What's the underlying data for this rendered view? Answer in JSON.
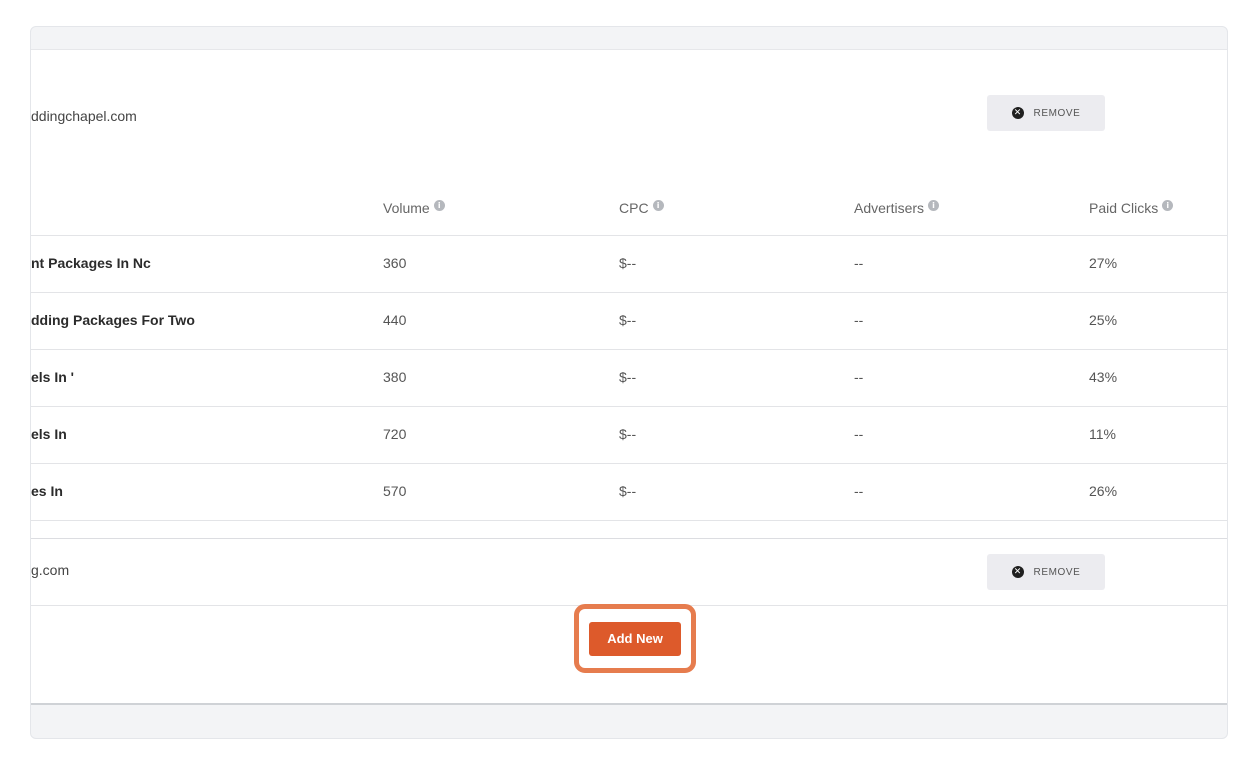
{
  "competitors": [
    {
      "domain": "ddingchapel.com",
      "remove_label": "REMOVE"
    },
    {
      "domain": "g.com",
      "remove_label": "REMOVE"
    }
  ],
  "table": {
    "headers": {
      "volume": "Volume",
      "cpc": "CPC",
      "advertisers": "Advertisers",
      "paid_clicks": "Paid Clicks"
    },
    "rows": [
      {
        "keyword": "nt Packages In Nc",
        "volume": "360",
        "cpc": "$--",
        "advertisers": "--",
        "paid_clicks": "27%"
      },
      {
        "keyword": "dding Packages For Two",
        "volume": "440",
        "cpc": "$--",
        "advertisers": "--",
        "paid_clicks": "25%"
      },
      {
        "keyword": "els In '",
        "volume": "380",
        "cpc": "$--",
        "advertisers": "--",
        "paid_clicks": "43%"
      },
      {
        "keyword": "els In",
        "volume": "720",
        "cpc": "$--",
        "advertisers": "--",
        "paid_clicks": "11%"
      },
      {
        "keyword": "es In",
        "volume": "570",
        "cpc": "$--",
        "advertisers": "--",
        "paid_clicks": "26%"
      }
    ]
  },
  "add_new_label": "Add New",
  "icons": {
    "remove": "close-circle-icon",
    "info": "info-icon"
  },
  "colors": {
    "accent": "#dd5a2b",
    "highlight": "#e67c4e"
  }
}
